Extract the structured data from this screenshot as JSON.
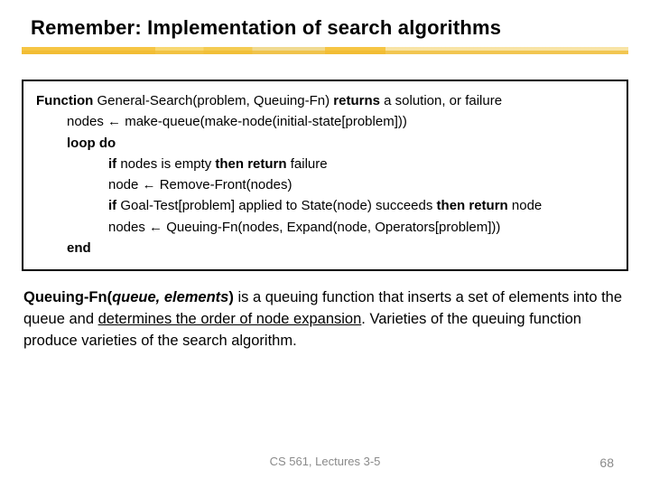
{
  "title": "Remember: Implementation of search algorithms",
  "code": {
    "l1_a": "Function",
    "l1_b": " General-Search(problem, Queuing-Fn) ",
    "l1_c": "returns",
    "l1_d": " a solution, or failure",
    "l2_a": "nodes ",
    "l2_arrow": "←",
    "l2_b": " make-queue(make-node(initial-state[problem]))",
    "l3": "loop do",
    "l4_a": "if",
    "l4_b": " nodes is empty ",
    "l4_c": "then return",
    "l4_d": " failure",
    "l5_a": "node ",
    "l5_arrow": "←",
    "l5_b": " Remove-Front(nodes)",
    "l6_a": "if",
    "l6_b": " Goal-Test[problem] applied to State(node) succeeds ",
    "l6_c": "then return",
    "l6_d": " node",
    "l7_a": "nodes ",
    "l7_arrow": "←",
    "l7_b": " Queuing-Fn(nodes, Expand(node, Operators[problem]))",
    "l8": "end"
  },
  "desc": {
    "p1a": "Queuing-Fn(",
    "p1b": "queue, elements",
    "p1c": ")",
    "p1d": " is a queuing function that inserts a set of elements into the queue and ",
    "p1u": "determines the order of node expansion",
    "p1e": ". Varieties of the queuing function produce varieties of the search algorithm."
  },
  "footer": {
    "center": "CS 561, Lectures 3-5",
    "page": "68"
  }
}
